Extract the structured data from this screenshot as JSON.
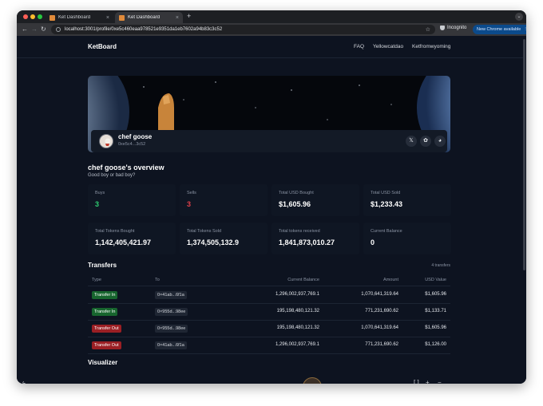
{
  "browser": {
    "tabs": [
      {
        "title": "Ket Dashboard",
        "close": "×"
      },
      {
        "title": "Ket Dashboard",
        "close": "×"
      }
    ],
    "new_tab": "+",
    "url": "localhost:3001/profile/0xe5c460eaa978521e9351da1eb7602a94b83c3c52",
    "incognito_label": "Incognito",
    "update_label": "New Chrome available"
  },
  "nav": {
    "brand": "KetBoard",
    "links": [
      "FAQ",
      "Yellowcatdao",
      "Ketfromwyoming"
    ]
  },
  "profile": {
    "name": "chef goose",
    "address_short": "0xe5c4...3c52",
    "socials": [
      {
        "icon": "x-icon",
        "glyph": "𝕏"
      },
      {
        "icon": "paw-icon",
        "glyph": "✿"
      },
      {
        "icon": "ball-icon",
        "glyph": "◕"
      }
    ]
  },
  "overview": {
    "title": "chef goose's overview",
    "subtitle": "Good boy or bad boy?",
    "stats": [
      {
        "label": "Buys",
        "value": "3",
        "color": "#2ecc71"
      },
      {
        "label": "Sells",
        "value": "3",
        "color": "#e0404a"
      },
      {
        "label": "Total USD Bought",
        "value": "$1,605.96",
        "color": "#ffffff"
      },
      {
        "label": "Total USD Sold",
        "value": "$1,233.43",
        "color": "#ffffff"
      },
      {
        "label": "Total Tokens Bought",
        "value": "1,142,405,421.97",
        "color": "#ffffff"
      },
      {
        "label": "Total Tokens Sold",
        "value": "1,374,505,132.9",
        "color": "#ffffff"
      },
      {
        "label": "Total tokens received",
        "value": "1,841,873,010.27",
        "color": "#ffffff"
      },
      {
        "label": "Current Balance",
        "value": "0",
        "color": "#ffffff"
      }
    ]
  },
  "transfers": {
    "title": "Transfers",
    "count": "4 transfers",
    "headers": [
      "Type",
      "To",
      "Current Balance",
      "Amount",
      "USD Value"
    ],
    "rows": [
      {
        "type": "Transfer In",
        "kind": "in",
        "to": "0×41ab...6f1a",
        "balance": "1,296,002,937,769.1",
        "amount": "1,070,641,319.64",
        "usd": "$1,605.96"
      },
      {
        "type": "Transfer In",
        "kind": "in",
        "to": "0×955d...98ee",
        "balance": "195,198,480,121.32",
        "amount": "771,231,690.62",
        "usd": "$1,133.71"
      },
      {
        "type": "Transfer Out",
        "kind": "out",
        "to": "0×955d...98ee",
        "balance": "195,198,480,121.32",
        "amount": "1,070,641,319.64",
        "usd": "$1,605.96"
      },
      {
        "type": "Transfer Out",
        "kind": "out",
        "to": "0×41ab...6f1a",
        "balance": "1,296,002,937,769.1",
        "amount": "771,231,690.62",
        "usd": "$1,126.00"
      }
    ]
  },
  "visualizer": {
    "title": "Visualizer"
  }
}
